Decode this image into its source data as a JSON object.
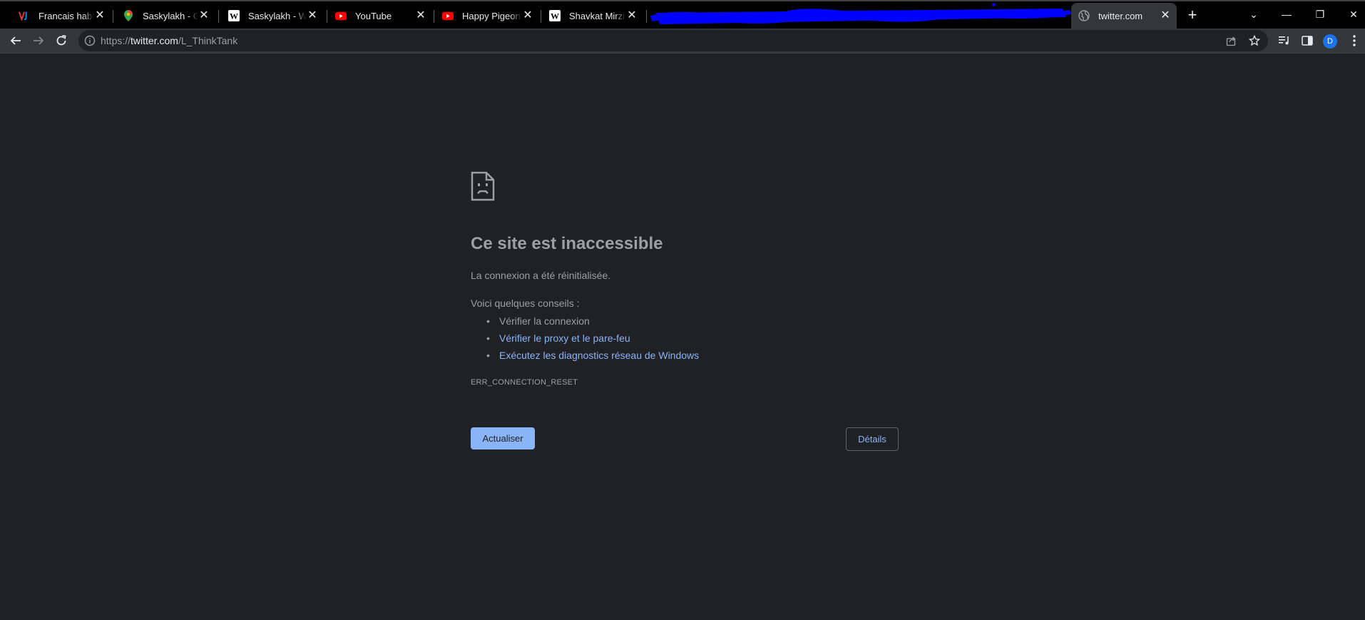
{
  "browser": {
    "tabs": [
      {
        "title": "Francais habitan",
        "favicon": "jv-icon"
      },
      {
        "title": "Saskylakh - Goo",
        "favicon": "maps-pin-icon"
      },
      {
        "title": "Saskylakh - Wiki",
        "favicon": "wikipedia-icon"
      },
      {
        "title": "YouTube",
        "favicon": "youtube-icon"
      },
      {
        "title": "Happy Pigeon N",
        "favicon": "youtube-icon"
      },
      {
        "title": "Shavkat Mirziyo",
        "favicon": "wikipedia-icon"
      },
      {
        "title": "",
        "favicon": "redacted"
      },
      {
        "title": "twitter.com",
        "favicon": "globe-icon",
        "active": true
      }
    ],
    "close_glyph": "✕",
    "new_tab_glyph": "+",
    "window_controls": {
      "tab_search": "⌄",
      "minimize": "—",
      "restore": "❐",
      "close": "✕"
    },
    "url": {
      "scheme": "https://",
      "host": "twitter.com",
      "path": "/L_ThinkTank"
    },
    "profile_initial": "D",
    "accent_colors": {
      "link": "#8ab4f8",
      "avatar": "#1a73e8",
      "redaction": "#0000ff"
    }
  },
  "error_page": {
    "heading": "Ce site est inaccessible",
    "description": "La connexion a été réinitialisée.",
    "tips_title": "Voici quelques conseils :",
    "tips": [
      {
        "text": "Vérifier la connexion",
        "link": false
      },
      {
        "text": "Vérifier le proxy et le pare-feu",
        "link": true
      },
      {
        "text": "Exécutez les diagnostics réseau de Windows",
        "link": true
      }
    ],
    "error_code": "ERR_CONNECTION_RESET",
    "reload_button": "Actualiser",
    "details_button": "Détails"
  }
}
